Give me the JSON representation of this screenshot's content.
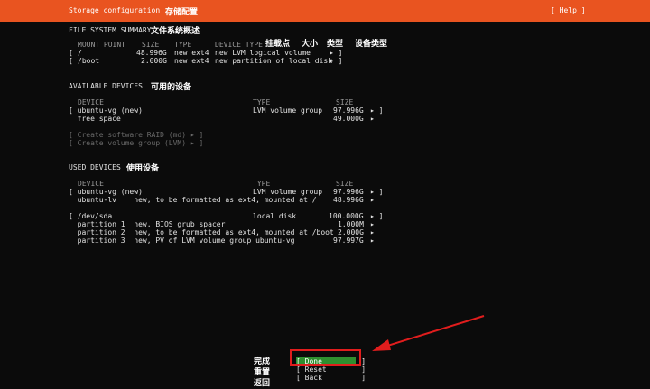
{
  "header": {
    "title": "Storage configuration",
    "title_cn": "存储配置",
    "help": "[ Help ]"
  },
  "fs_summary": {
    "title": "FILE SYSTEM SUMMARY",
    "title_cn": "文件系统概述",
    "columns": [
      "MOUNT POINT",
      "SIZE",
      "TYPE",
      "DEVICE TYPE"
    ],
    "columns_cn": [
      "挂载点",
      "大小",
      "类型",
      "设备类型"
    ],
    "rows": [
      {
        "bracket": "[",
        "mount": "/",
        "size": "48.996G",
        "type": "new ext4",
        "device_type": "new LVM logical volume",
        "arrow": "▸ ]"
      },
      {
        "bracket": "[",
        "mount": "/boot",
        "size": "2.000G",
        "type": "new ext4",
        "device_type": "new partition of local disk",
        "arrow": "▸ ]"
      }
    ]
  },
  "available": {
    "title": "AVAILABLE DEVICES",
    "title_cn": "可用的设备",
    "columns": [
      "DEVICE",
      "TYPE",
      "SIZE"
    ],
    "rows": [
      {
        "device": "[ ubuntu-vg (new)",
        "type": "LVM volume group",
        "size": "97.996G",
        "arrow": "▸ ]"
      },
      {
        "device": "  free space",
        "type": "",
        "size": "49.000G",
        "arrow": "▸"
      }
    ],
    "actions": [
      "[ Create software RAID (md) ▸ ]",
      "[ Create volume group (LVM) ▸ ]"
    ]
  },
  "used": {
    "title": "USED DEVICES",
    "title_cn": "使用设备",
    "columns": [
      "DEVICE",
      "TYPE",
      "SIZE"
    ],
    "rows": [
      {
        "device": "[ ubuntu-vg (new)",
        "type": "LVM volume group",
        "size": "97.996G",
        "arrow": "▸ ]"
      },
      {
        "device": "  ubuntu-lv    new, to be formatted as ext4, mounted at /",
        "type": "",
        "size": "48.996G",
        "arrow": "▸"
      },
      {
        "device": "[ /dev/sda",
        "type": "local disk",
        "size": "100.000G",
        "arrow": "▸ ]"
      },
      {
        "device": "  partition 1  new, BIOS grub spacer",
        "type": "",
        "size": "1.000M",
        "arrow": "▸"
      },
      {
        "device": "  partition 2  new, to be formatted as ext4, mounted at /boot",
        "type": "",
        "size": "2.000G",
        "arrow": "▸"
      },
      {
        "device": "  partition 3  new, PV of LVM volume group ubuntu-vg",
        "type": "",
        "size": "97.997G",
        "arrow": "▸"
      }
    ]
  },
  "buttons": {
    "done": "[ Done         ]",
    "reset": "[ Reset        ]",
    "back": "[ Back         ]",
    "done_cn": "完成",
    "reset_cn": "重置",
    "back_cn": "返回"
  },
  "colors": {
    "header_bg": "#e95420",
    "done_bg": "#2f8f2f",
    "annotation_red": "#e11d1d"
  }
}
